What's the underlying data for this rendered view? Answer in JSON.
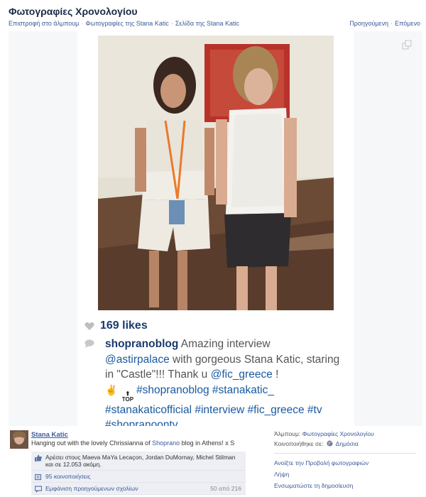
{
  "header": {
    "title": "Φωτογραφίες Χρονολογίου",
    "breadcrumbs": [
      "Επιστροφή στο άλμπουμ",
      "Φωτογραφίες της Stana Katic",
      "Σελίδα της Stana Katic"
    ],
    "pager": {
      "prev": "Προηγούμενη",
      "next": "Επόμενο"
    }
  },
  "instagram": {
    "likes": "169 likes",
    "username": "shopranoblog",
    "caption_1": " Amazing interview ",
    "mention_1": "@astirpalace",
    "caption_2": " with gorgeous Stana Katic, staring in \"Castle\"!!! Thank u ",
    "mention_2": "@fic_greece",
    "caption_3": " !",
    "emoji_hand": "✌",
    "top_badge": "TOP",
    "tags_line1": "#shopranoblog #stanakatic_",
    "tags_line2": "#stanakaticofficial #interview #fic_greece #tv",
    "tags_line3": "#shopranoontv"
  },
  "post": {
    "author": "Stana Katic",
    "text_before": "Hanging out with the lovely Chrissianna of ",
    "text_link": "Shoprano",
    "text_after": " blog in Athens! x S"
  },
  "engagement": {
    "likes_text": "Αρέσει στους Maeva MaYa Lecaçon, Jordan DuMornay, Michel Stilman και σε 12.053 ακόμη.",
    "shares": "95 κοινοποιήσεις",
    "prev_comments": "Εμφάνιση προηγούμενων σχολίων",
    "comment_count": "50 από 216"
  },
  "side": {
    "album_label": "Άλμπουμ:",
    "album_link": "Φωτογραφίες Χρονολογίου",
    "shared_label": "Κοινοποιήθηκε σε:",
    "shared_value": "Δημόσια",
    "actions": [
      "Ανοίξτε την Προβολή φωτογραφιών",
      "Λήψη",
      "Ενσωματώστε τη δημοσίευση"
    ]
  },
  "icons": {
    "expand": "expand-icon",
    "heart": "heart-icon",
    "comment": "comment-bubble-icon",
    "like": "thumbs-up-icon",
    "share": "share-icon",
    "comments": "comments-icon",
    "globe": "globe-icon"
  },
  "colors": {
    "fb_blue": "#3b5998",
    "insta_blue": "#1a3a6c",
    "stage_bg": "#f6f7f9"
  }
}
